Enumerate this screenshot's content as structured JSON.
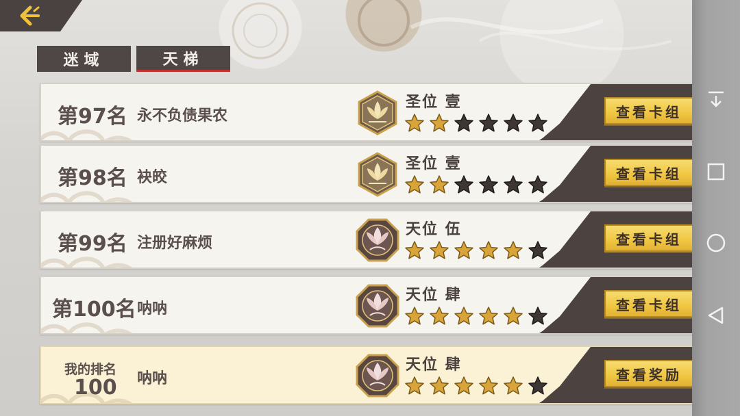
{
  "tabs": [
    {
      "label": "迷域",
      "active": false
    },
    {
      "label": "天梯",
      "active": true
    }
  ],
  "rows": [
    {
      "rank": "第97名",
      "name": "永不负债果农",
      "tier": "圣位 壹",
      "stars_filled": 2,
      "stars_total": 6,
      "button": "查看卡组"
    },
    {
      "rank": "第98名",
      "name": "袂皎",
      "tier": "圣位 壹",
      "stars_filled": 2,
      "stars_total": 6,
      "button": "查看卡组"
    },
    {
      "rank": "第99名",
      "name": "注册好麻烦",
      "tier": "天位 伍",
      "stars_filled": 5,
      "stars_total": 6,
      "button": "查看卡组"
    },
    {
      "rank": "第100名",
      "name": "呐呐",
      "tier": "天位 肆",
      "stars_filled": 5,
      "stars_total": 6,
      "button": "查看卡组"
    }
  ],
  "my_row": {
    "label": "我的排名",
    "rank": "100",
    "name": "呐呐",
    "tier": "天位 肆",
    "stars_filled": 5,
    "stars_total": 6,
    "button": "查看奖励"
  },
  "icons": {
    "back": "back-arrow-icon",
    "emblem_holy": "lotus-hexagon-emblem-icon",
    "emblem_sky": "lotus-octagon-emblem-icon",
    "sys_collapse": "collapse-down-icon",
    "sys_recent": "square-recent-icon",
    "sys_home": "circle-home-icon",
    "sys_back": "triangle-back-icon"
  },
  "colors": {
    "star_filled": "#d9a43a",
    "star_empty": "#3d3634",
    "button_gold": "#efc642",
    "dark_panel": "#4c4341",
    "active_tab_underline": "#c0302c"
  }
}
